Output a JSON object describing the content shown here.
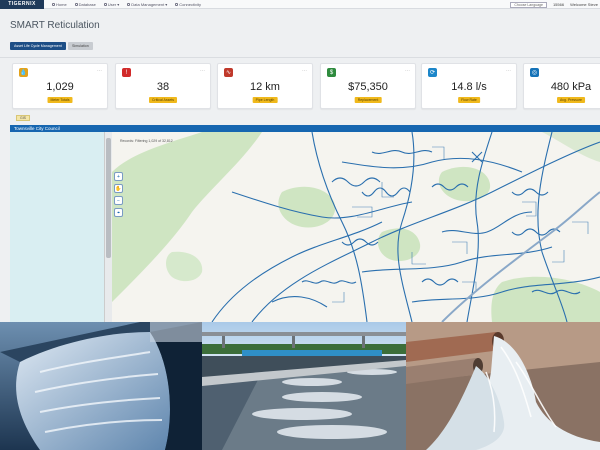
{
  "app": {
    "logo": "TIGERNIX",
    "title": "SMART Reticulation"
  },
  "nav": {
    "items": [
      "Home",
      "Database",
      "User",
      "Data Management",
      "Connectivity"
    ]
  },
  "topright": {
    "language_label": "Choose Language",
    "number": "15566",
    "welcome": "Welcome Steve"
  },
  "buttons": {
    "asset": "Asset Life Cycle Management",
    "simulation": "Simulation"
  },
  "cards": [
    {
      "value": "1,029",
      "label": "Meter Totals",
      "icon": "water-drop-icon",
      "color": "#e3a21a"
    },
    {
      "value": "38",
      "label": "Critical Assets",
      "icon": "warning-icon",
      "color": "#d12a2a"
    },
    {
      "value": "12 km",
      "label": "Pipe Length",
      "icon": "pulse-icon",
      "color": "#c0392b"
    },
    {
      "value": "$75,350",
      "label": "Replacement",
      "icon": "dollar-icon",
      "color": "#2e8b3e"
    },
    {
      "value": "14.8 l/s",
      "label": "Flow Rate",
      "icon": "flow-icon",
      "color": "#1c86c9"
    },
    {
      "value": "480 kPa",
      "label": "Avg. Pressure",
      "icon": "gauge-icon",
      "color": "#1573b8"
    }
  ],
  "gis": {
    "tab": "GIS"
  },
  "map": {
    "panel_title": "Townsville City Council",
    "caption": "Records: Filtering 1,029 of 32,812"
  },
  "colors": {
    "primary": "#1d4e86",
    "header_blue": "#1666b0",
    "badge": "#f0b91c",
    "pipe": "#2a6fae",
    "park": "#cfe5c2"
  }
}
